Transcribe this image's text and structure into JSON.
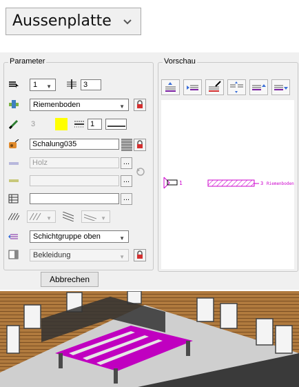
{
  "top_dropdown": {
    "value": "Aussenplatte",
    "icon": "chevron-down-icon"
  },
  "parameter": {
    "legend": "Parameter",
    "layer_number": "1",
    "spacing_value": "3",
    "material_select": "Riemenboden",
    "color_index": "3",
    "color_swatch": "#ffff00",
    "line_weight": "1",
    "surface_texture": "Schalung035",
    "hatch_material": "Holz",
    "layer_group": "Schichtgruppe oben",
    "cladding": "Bekleidung"
  },
  "vorschau": {
    "legend": "Vorschau",
    "preview_left_label": "1",
    "preview_right_label": "3",
    "preview_right_text": "Riemenboden",
    "hatch_color": "#cc00cc"
  },
  "buttons": {
    "cancel": "Abbrechen",
    "dots": "..."
  }
}
